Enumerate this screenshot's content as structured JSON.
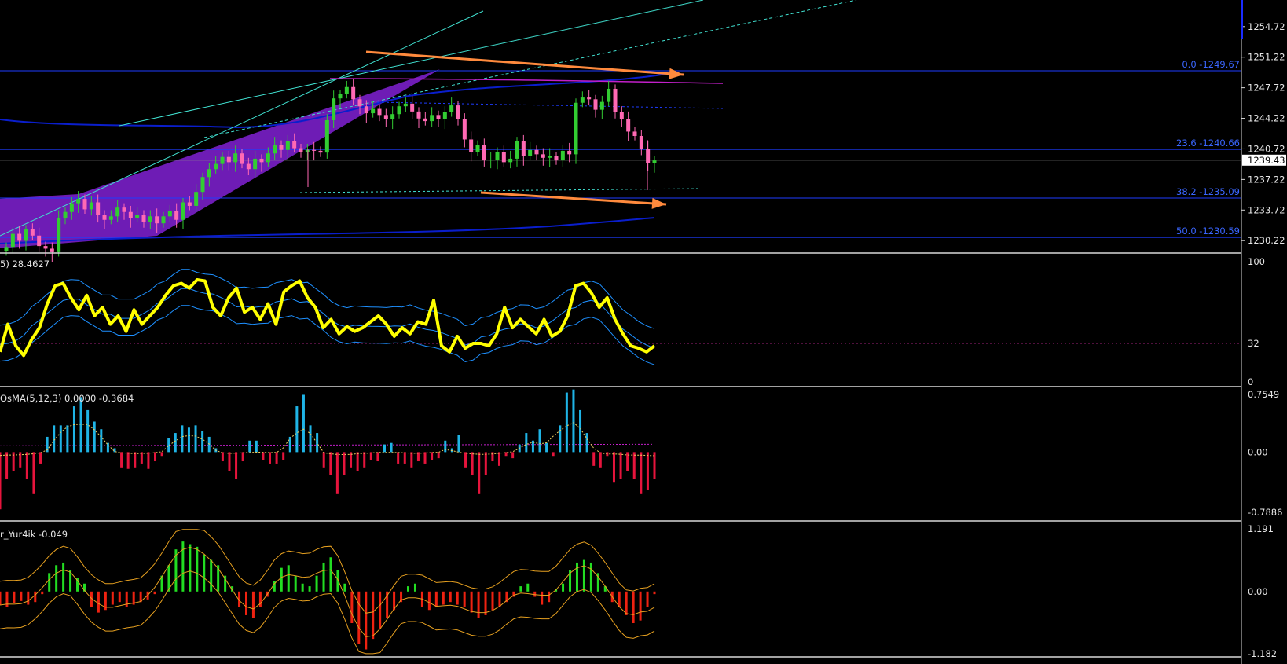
{
  "colors": {
    "background": "#000000",
    "bull_candle": "#32cd32",
    "bear_candle": "#ff69b4",
    "fib_line": "#1e3cff",
    "ma_line": "#0a1ecc",
    "channel_line": "#40e0d0",
    "channel_fill": "#7a1fc9",
    "magenta_line": "#c21fc9",
    "arrow": "#ff8a3d",
    "stoch_main": "#ffff00",
    "stoch_band": "#1e90ff",
    "osma_pos": "#1fb4e6",
    "osma_neg": "#e6143c",
    "osc_pos": "#22dd22",
    "osc_neg": "#ee2211",
    "osc_band": "#e6a020"
  },
  "chart_data": [
    {
      "type": "candlestick",
      "title": "",
      "ylim": [
        1228.8,
        1257.4
      ],
      "y_ticks": [
        "1254.72",
        "1251.22",
        "1247.72",
        "1244.22",
        "1240.72",
        "1237.22",
        "1233.72",
        "1230.22"
      ],
      "current_price": "1239.43",
      "fib_levels": [
        {
          "label": "0.0 -1249.67",
          "value": 1249.67
        },
        {
          "label": "23.6 -1240.66",
          "value": 1240.66
        },
        {
          "label": "38.2 -1235.09",
          "value": 1235.09
        },
        {
          "label": "50.0 -1230.59",
          "value": 1230.59
        }
      ],
      "candles_close": [
        1229.5,
        1231.0,
        1230.2,
        1231.5,
        1230.8,
        1229.6,
        1229.3,
        1228.9,
        1232.8,
        1233.5,
        1234.5,
        1235.0,
        1233.8,
        1234.6,
        1233.2,
        1232.6,
        1233.0,
        1234.0,
        1233.5,
        1232.8,
        1233.2,
        1232.4,
        1233.0,
        1232.2,
        1233.0,
        1233.6,
        1232.6,
        1234.6,
        1234.2,
        1235.8,
        1237.5,
        1238.4,
        1239.0,
        1239.8,
        1239.2,
        1240.2,
        1239.0,
        1238.4,
        1239.6,
        1239.2,
        1240.2,
        1241.2,
        1240.6,
        1241.6,
        1240.8,
        1240.4,
        1240.6,
        1240.5,
        1240.3,
        1244.0,
        1246.5,
        1247.0,
        1247.8,
        1246.4,
        1245.6,
        1244.8,
        1245.3,
        1244.6,
        1244.1,
        1244.7,
        1245.6,
        1245.9,
        1245.0,
        1244.2,
        1243.9,
        1244.6,
        1244.1,
        1244.9,
        1245.7,
        1244.1,
        1241.8,
        1240.4,
        1241.2,
        1239.4,
        1239.5,
        1240.4,
        1239.2,
        1239.6,
        1241.6,
        1239.9,
        1240.6,
        1240.1,
        1239.7,
        1239.9,
        1239.4,
        1240.5,
        1240.1,
        1246.0,
        1246.6,
        1246.4,
        1245.2,
        1246.1,
        1247.6,
        1244.9,
        1244.1,
        1242.7,
        1242.2,
        1240.7,
        1239.1,
        1239.4
      ],
      "candles_open_delta_note": ""
    },
    {
      "type": "line",
      "title": "",
      "label": "5) 28.4627",
      "ylim": [
        0,
        100
      ],
      "y_ticks": [
        "100",
        "32",
        "0"
      ],
      "level": 32,
      "series": [
        {
          "values": [
            25,
            48,
            30,
            22,
            35,
            45,
            65,
            80,
            82,
            70,
            60,
            72,
            55,
            62,
            48,
            55,
            42,
            60,
            48,
            55,
            62,
            72,
            80,
            82,
            78,
            85,
            84,
            62,
            55,
            70,
            78,
            58,
            62,
            52,
            65,
            48,
            75,
            80,
            84,
            70,
            62,
            45,
            52,
            40,
            46,
            42,
            45,
            50,
            55,
            48,
            38,
            45,
            40,
            50,
            48,
            68,
            30,
            25,
            38,
            28,
            32,
            32,
            30,
            40,
            62,
            45,
            52,
            46,
            40,
            52,
            38,
            42,
            55,
            80,
            82,
            74,
            62,
            70,
            52,
            40,
            30,
            28,
            25,
            30
          ]
        }
      ]
    },
    {
      "type": "bar",
      "title": "",
      "label": "OsMA(5,12,3) 0.0000 -0.3684",
      "ylim": [
        -0.7886,
        0.7549
      ],
      "y_ticks": [
        "0.7549",
        "0.00",
        "-0.7886"
      ],
      "values": [
        -0.75,
        -0.35,
        -0.25,
        -0.2,
        -0.35,
        -0.55,
        -0.15,
        0.2,
        0.35,
        0.35,
        0.35,
        0.6,
        0.72,
        0.55,
        0.4,
        0.3,
        0.12,
        0.05,
        -0.2,
        -0.22,
        -0.2,
        -0.15,
        -0.22,
        -0.12,
        -0.05,
        0.18,
        0.25,
        0.35,
        0.32,
        0.35,
        0.28,
        0.2,
        0.05,
        -0.12,
        -0.25,
        -0.35,
        -0.12,
        0.15,
        0.15,
        -0.1,
        -0.15,
        -0.15,
        -0.1,
        0.2,
        0.6,
        0.75,
        0.35,
        0.25,
        -0.2,
        -0.3,
        -0.55,
        -0.3,
        -0.2,
        -0.25,
        -0.2,
        -0.1,
        -0.12,
        0.1,
        0.12,
        -0.15,
        -0.15,
        -0.2,
        -0.12,
        -0.15,
        -0.1,
        -0.08,
        0.15,
        0.05,
        0.22,
        -0.2,
        -0.3,
        -0.55,
        -0.3,
        -0.12,
        -0.18,
        -0.05,
        -0.08,
        0.1,
        0.25,
        0.15,
        0.3,
        0.12,
        -0.05,
        0.35,
        0.78,
        0.82,
        0.55,
        0.25,
        -0.18,
        -0.2,
        -0.05,
        -0.4,
        -0.35,
        -0.25,
        -0.35,
        -0.55,
        -0.5,
        -0.35
      ]
    },
    {
      "type": "bar",
      "title": "",
      "label": "r_Yur4ik -0.049",
      "ylim": [
        -1.182,
        1.191
      ],
      "y_ticks": [
        "1.191",
        "0.00",
        "-1.182"
      ],
      "values": [
        -0.25,
        -0.3,
        -0.22,
        -0.18,
        -0.25,
        -0.2,
        -0.05,
        0.35,
        0.5,
        0.55,
        0.4,
        0.25,
        0.15,
        -0.3,
        -0.4,
        -0.35,
        -0.25,
        -0.2,
        -0.3,
        -0.25,
        -0.2,
        -0.15,
        -0.05,
        0.3,
        0.5,
        0.8,
        0.95,
        0.9,
        0.85,
        0.7,
        0.6,
        0.5,
        0.3,
        0.1,
        -0.3,
        -0.45,
        -0.5,
        -0.3,
        -0.1,
        0.2,
        0.45,
        0.5,
        0.3,
        0.15,
        0.1,
        0.3,
        0.55,
        0.65,
        0.4,
        0.15,
        -0.6,
        -1.0,
        -1.1,
        -0.9,
        -0.7,
        -0.5,
        -0.35,
        -0.2,
        0.1,
        0.15,
        -0.3,
        -0.35,
        -0.3,
        -0.25,
        -0.2,
        -0.25,
        -0.3,
        -0.4,
        -0.5,
        -0.45,
        -0.35,
        -0.3,
        -0.2,
        -0.1,
        0.1,
        0.15,
        -0.1,
        -0.25,
        -0.2,
        0.05,
        0.15,
        0.4,
        0.55,
        0.6,
        0.55,
        0.35,
        0.1,
        -0.2,
        -0.3,
        -0.45,
        -0.6,
        -0.55,
        -0.3,
        -0.05
      ]
    }
  ]
}
